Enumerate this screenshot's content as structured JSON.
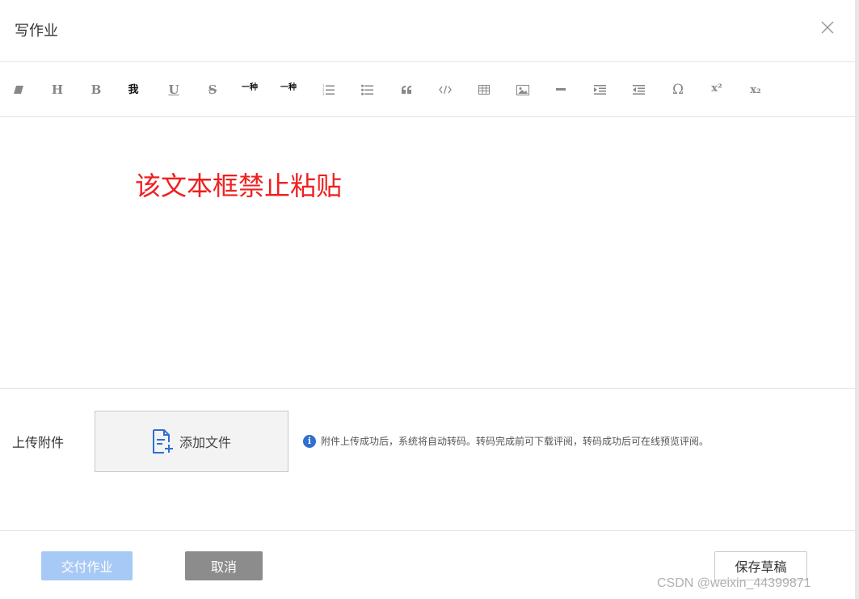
{
  "dialog": {
    "title": "写作业",
    "close_icon": "close-icon"
  },
  "toolbar": {
    "items": [
      {
        "name": "eraser",
        "icon": "eraser-icon"
      },
      {
        "name": "heading",
        "label": "H"
      },
      {
        "name": "bold",
        "label": "B"
      },
      {
        "name": "font",
        "label": "我"
      },
      {
        "name": "underline",
        "label": "U"
      },
      {
        "name": "strikethrough",
        "label": "S"
      },
      {
        "name": "font-family",
        "label": "一种"
      },
      {
        "name": "font-size",
        "label": "一种"
      },
      {
        "name": "ordered-list",
        "icon": "ordered-list-icon"
      },
      {
        "name": "unordered-list",
        "icon": "unordered-list-icon"
      },
      {
        "name": "quote",
        "icon": "quote-icon"
      },
      {
        "name": "code",
        "icon": "code-icon"
      },
      {
        "name": "table",
        "icon": "table-icon"
      },
      {
        "name": "image",
        "icon": "image-icon"
      },
      {
        "name": "horizontal-rule",
        "icon": "horizontal-rule-icon"
      },
      {
        "name": "indent",
        "icon": "indent-icon"
      },
      {
        "name": "outdent",
        "icon": "outdent-icon"
      },
      {
        "name": "special-char",
        "label": "Ω"
      },
      {
        "name": "superscript",
        "label": "x²"
      },
      {
        "name": "subscript",
        "label": "x₂"
      }
    ]
  },
  "editor": {
    "note": "该文本框禁止粘贴",
    "note_color": "#f01f1f"
  },
  "attachment": {
    "label": "上传附件",
    "add_file_label": "添加文件",
    "add_file_icon": "file-add-icon",
    "info_icon": "info-icon",
    "info_text": "附件上传成功后，系统将自动转码。转码完成前可下载评阅，转码成功后可在线预览评阅。"
  },
  "footer": {
    "submit_label": "交付作业",
    "cancel_label": "取消",
    "save_draft_label": "保存草稿",
    "submit_color": "#a7c9f5",
    "cancel_color": "#8c8c8c"
  },
  "watermark": "CSDN @weixin_44399871"
}
